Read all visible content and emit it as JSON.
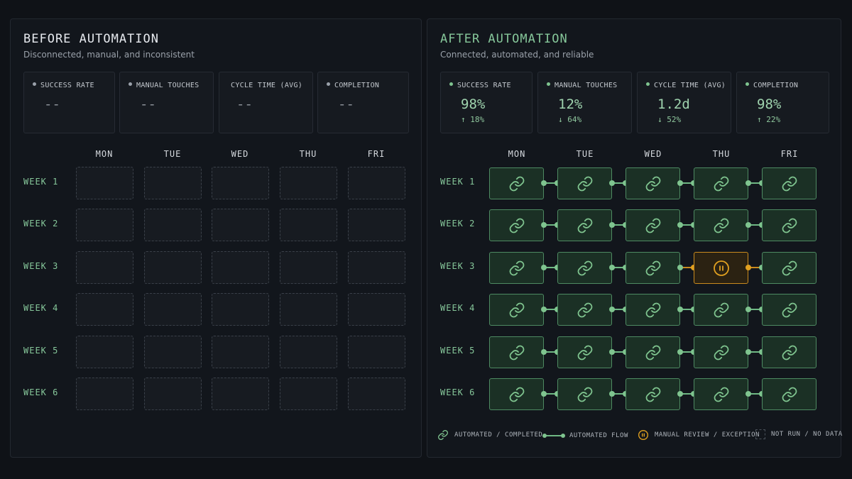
{
  "before": {
    "title": "BEFORE AUTOMATION",
    "subtitle": "Disconnected, manual, and inconsistent",
    "stats": [
      {
        "label": "SUCCESS RATE",
        "value": "--",
        "dot": true
      },
      {
        "label": "MANUAL TOUCHES",
        "value": "--",
        "dot": true
      },
      {
        "label": "CYCLE TIME (AVG)",
        "value": "--",
        "dot": false
      },
      {
        "label": "COMPLETION",
        "value": "--",
        "dot": true
      }
    ]
  },
  "after": {
    "title": "AFTER AUTOMATION",
    "subtitle": "Connected, automated, and reliable",
    "stats": [
      {
        "label": "SUCCESS RATE",
        "value": "98%",
        "delta": "↑ 18%"
      },
      {
        "label": "MANUAL TOUCHES",
        "value": "12%",
        "delta": "↓ 64%"
      },
      {
        "label": "CYCLE TIME (AVG)",
        "value": "1.2d",
        "delta": "↓ 52%"
      },
      {
        "label": "COMPLETION",
        "value": "98%",
        "delta": "↑ 22%"
      }
    ]
  },
  "days": [
    "MON",
    "TUE",
    "WED",
    "THU",
    "FRI"
  ],
  "weeks": [
    "WEEK 1",
    "WEEK 2",
    "WEEK 3",
    "WEEK 4",
    "WEEK 5",
    "WEEK 6"
  ],
  "after_grid": [
    [
      "done",
      "done",
      "done",
      "done",
      "done"
    ],
    [
      "done",
      "done",
      "done",
      "done",
      "done"
    ],
    [
      "done",
      "done",
      "done",
      "review",
      "done"
    ],
    [
      "done",
      "done",
      "done",
      "done",
      "done"
    ],
    [
      "done",
      "done",
      "done",
      "done",
      "done"
    ],
    [
      "done",
      "done",
      "done",
      "done",
      "done"
    ]
  ],
  "legend": {
    "completed": "AUTOMATED / COMPLETED",
    "flow": "AUTOMATED FLOW",
    "review": "MANUAL REVIEW / EXCEPTION",
    "notrun": "NOT RUN / NO DATA"
  },
  "colors": {
    "accent_green": "#7fc48f",
    "exception_orange": "#e0a020",
    "background": "#0f1217"
  }
}
